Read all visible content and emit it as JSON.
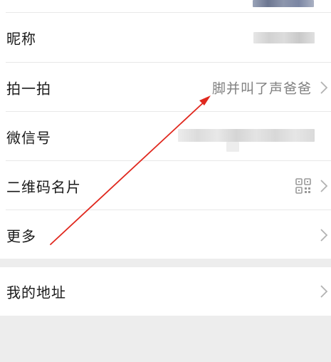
{
  "profile": {
    "rows": [
      {
        "label": "昵称"
      },
      {
        "label": "拍一拍",
        "value": "脚并叫了声爸爸"
      },
      {
        "label": "微信号"
      },
      {
        "label": "二维码名片"
      },
      {
        "label": "更多"
      }
    ],
    "address": {
      "label": "我的地址"
    }
  },
  "colors": {
    "page_background": "#ededed",
    "card_background": "#ffffff",
    "value_text": "#808080",
    "annotation_arrow": "#e0281e"
  },
  "icons": {
    "chevron": "chevron-right-icon",
    "qr": "qr-code-icon"
  }
}
